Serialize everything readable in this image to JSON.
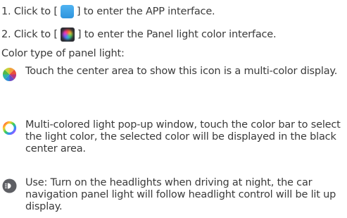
{
  "steps": [
    {
      "before": "1. Click to [",
      "after": "] to enter the APP interface.",
      "icon": "blue-app-square-icon"
    },
    {
      "before": "2. Click to [",
      "after": "] to enter the Panel light color interface.",
      "icon": "panel-light-color-icon"
    }
  ],
  "color_type_heading": "Color type of panel light:",
  "items": [
    {
      "icon": "multicolor-pie-icon",
      "text": "Touch the center area to show this icon is a multi-color display."
    },
    {
      "icon": "color-ring-icon",
      "text": "Multi-colored light pop-up window, touch the color bar to select the light color, the selected color will be displayed in the black center area."
    },
    {
      "icon": "headlight-icon",
      "text": "Use: Turn on the headlights when driving at night, the car navigation panel light will follow headlight control will be lit up display."
    }
  ]
}
